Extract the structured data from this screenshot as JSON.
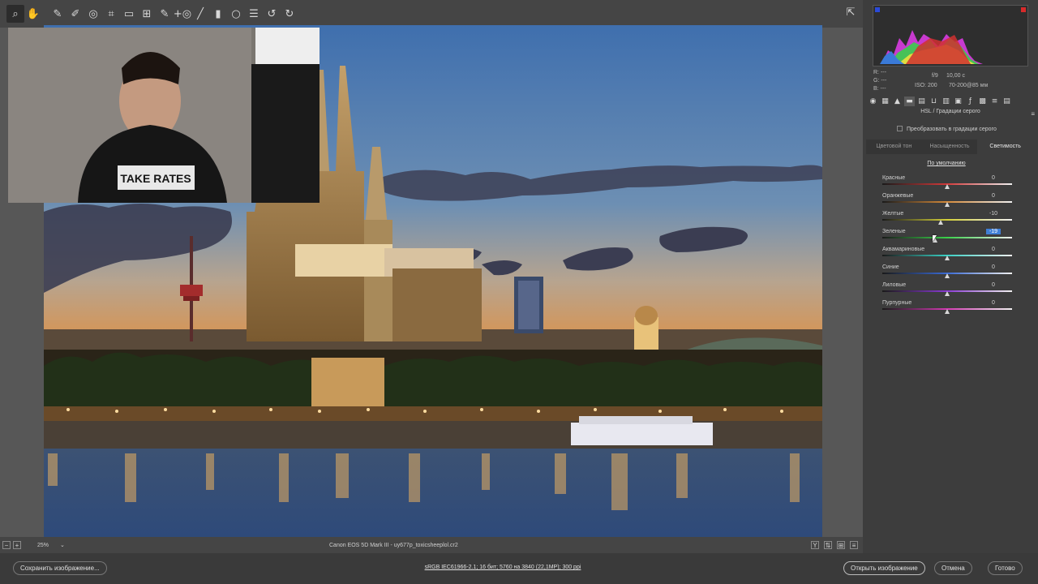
{
  "toolbar": {
    "tools": [
      "zoom-icon",
      "hand-icon",
      "white-balance-icon",
      "color-sampler-icon",
      "target-adjust-icon",
      "crop-icon",
      "straighten-icon",
      "transform-icon",
      "spot-removal-icon",
      "red-eye-icon",
      "brush-icon",
      "graduated-filter-icon",
      "radial-filter-icon",
      "presets-icon",
      "rotate-left-icon",
      "rotate-right-icon"
    ]
  },
  "histogram": {
    "r": "R:  ---",
    "g": "G:  ---",
    "b": "B:  ---",
    "aperture": "f/9",
    "shutter": "10,00 с",
    "iso": "ISO: 200",
    "lens": "70-200@85 мм"
  },
  "panel": {
    "section_title": "HSL / Градации серого",
    "grayscale_label": "Преобразовать в градации серого",
    "tabs": [
      "Цветовой тон",
      "Насыщенность",
      "Светимость"
    ],
    "active_tab": "Светимость",
    "default_link": "По умолчанию",
    "sliders": [
      {
        "label": "Красные",
        "value": "0",
        "pos": 0.5
      },
      {
        "label": "Оранжевые",
        "value": "0",
        "pos": 0.5
      },
      {
        "label": "Желтые",
        "value": "-10",
        "pos": 0.45
      },
      {
        "label": "Зеленые",
        "value": "-19",
        "pos": 0.405
      },
      {
        "label": "Аквамариновые",
        "value": "0",
        "pos": 0.5
      },
      {
        "label": "Синие",
        "value": "0",
        "pos": 0.5
      },
      {
        "label": "Лиловые",
        "value": "0",
        "pos": 0.5
      },
      {
        "label": "Пурпурные",
        "value": "0",
        "pos": 0.5
      }
    ]
  },
  "status": {
    "zoom": "25%",
    "filename": "Canon EOS 5D Mark III  -  uy677p_toxicsheeplol.cr2"
  },
  "bottom": {
    "save_label": "Сохранить изображение...",
    "info": "sRGB IEC61966-2.1; 16 бит; 5760 на 3840 (22,1МР); 300 ppi",
    "open_label": "Открыть изображение",
    "cancel_label": "Отмена",
    "done_label": "Готово"
  },
  "webcam": {
    "shirt_text": "TAKE RATES"
  },
  "colors": {
    "accent": "#3f7fd6",
    "panel_bg": "#3d3d3d",
    "canvas_bg": "#575757"
  }
}
